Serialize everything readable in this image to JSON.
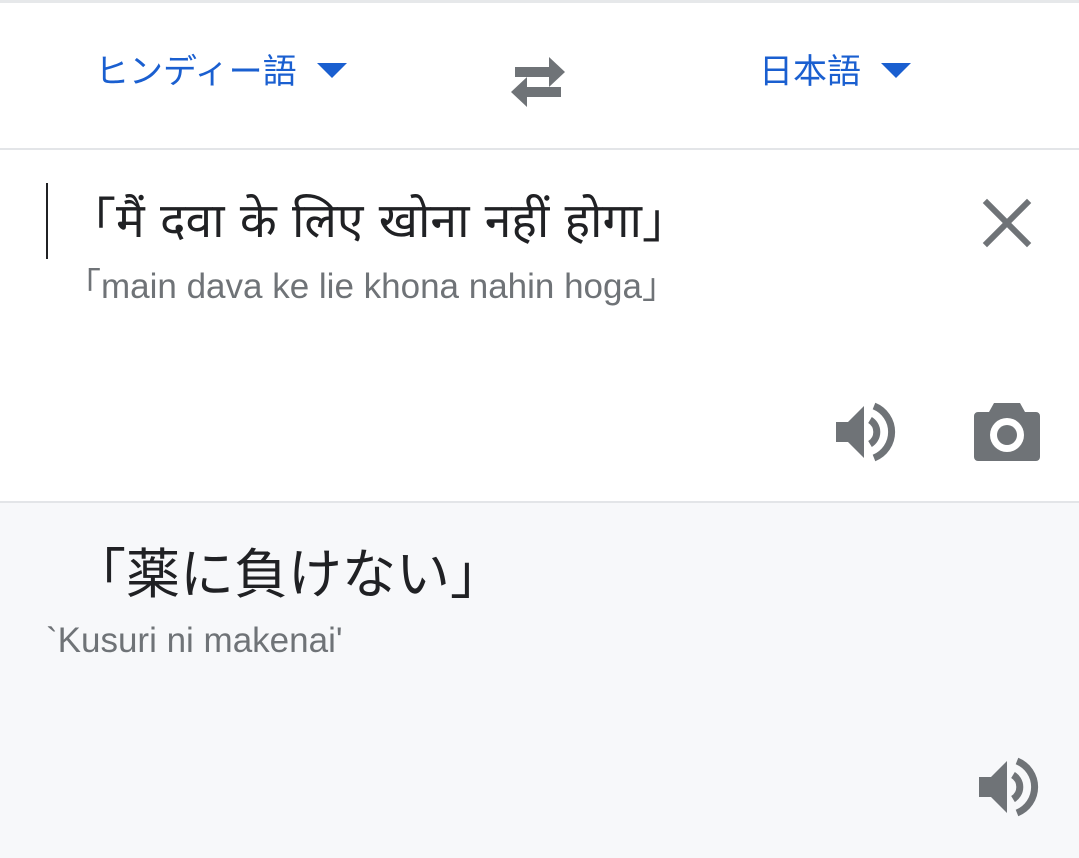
{
  "header": {
    "source_language": "ヒンディー語",
    "target_language": "日本語",
    "swap_icon": "swap-arrows-icon",
    "dropdown_icon": "caret-down-icon"
  },
  "input": {
    "text": "「मैं दवा के लिए खोना नहीं होगा」",
    "transliteration": "「main dava ke lie khona nahin hoga」",
    "clear_icon": "close-icon",
    "speak_icon": "speaker-icon",
    "camera_icon": "camera-icon"
  },
  "output": {
    "text": "「薬に負けない」",
    "transliteration": "`Kusuri ni makenai'",
    "speak_icon": "speaker-icon"
  },
  "colors": {
    "accent": "#1a5fd0",
    "icon": "#6f7377",
    "text": "#202124",
    "output_bg": "#f7f8fa"
  }
}
